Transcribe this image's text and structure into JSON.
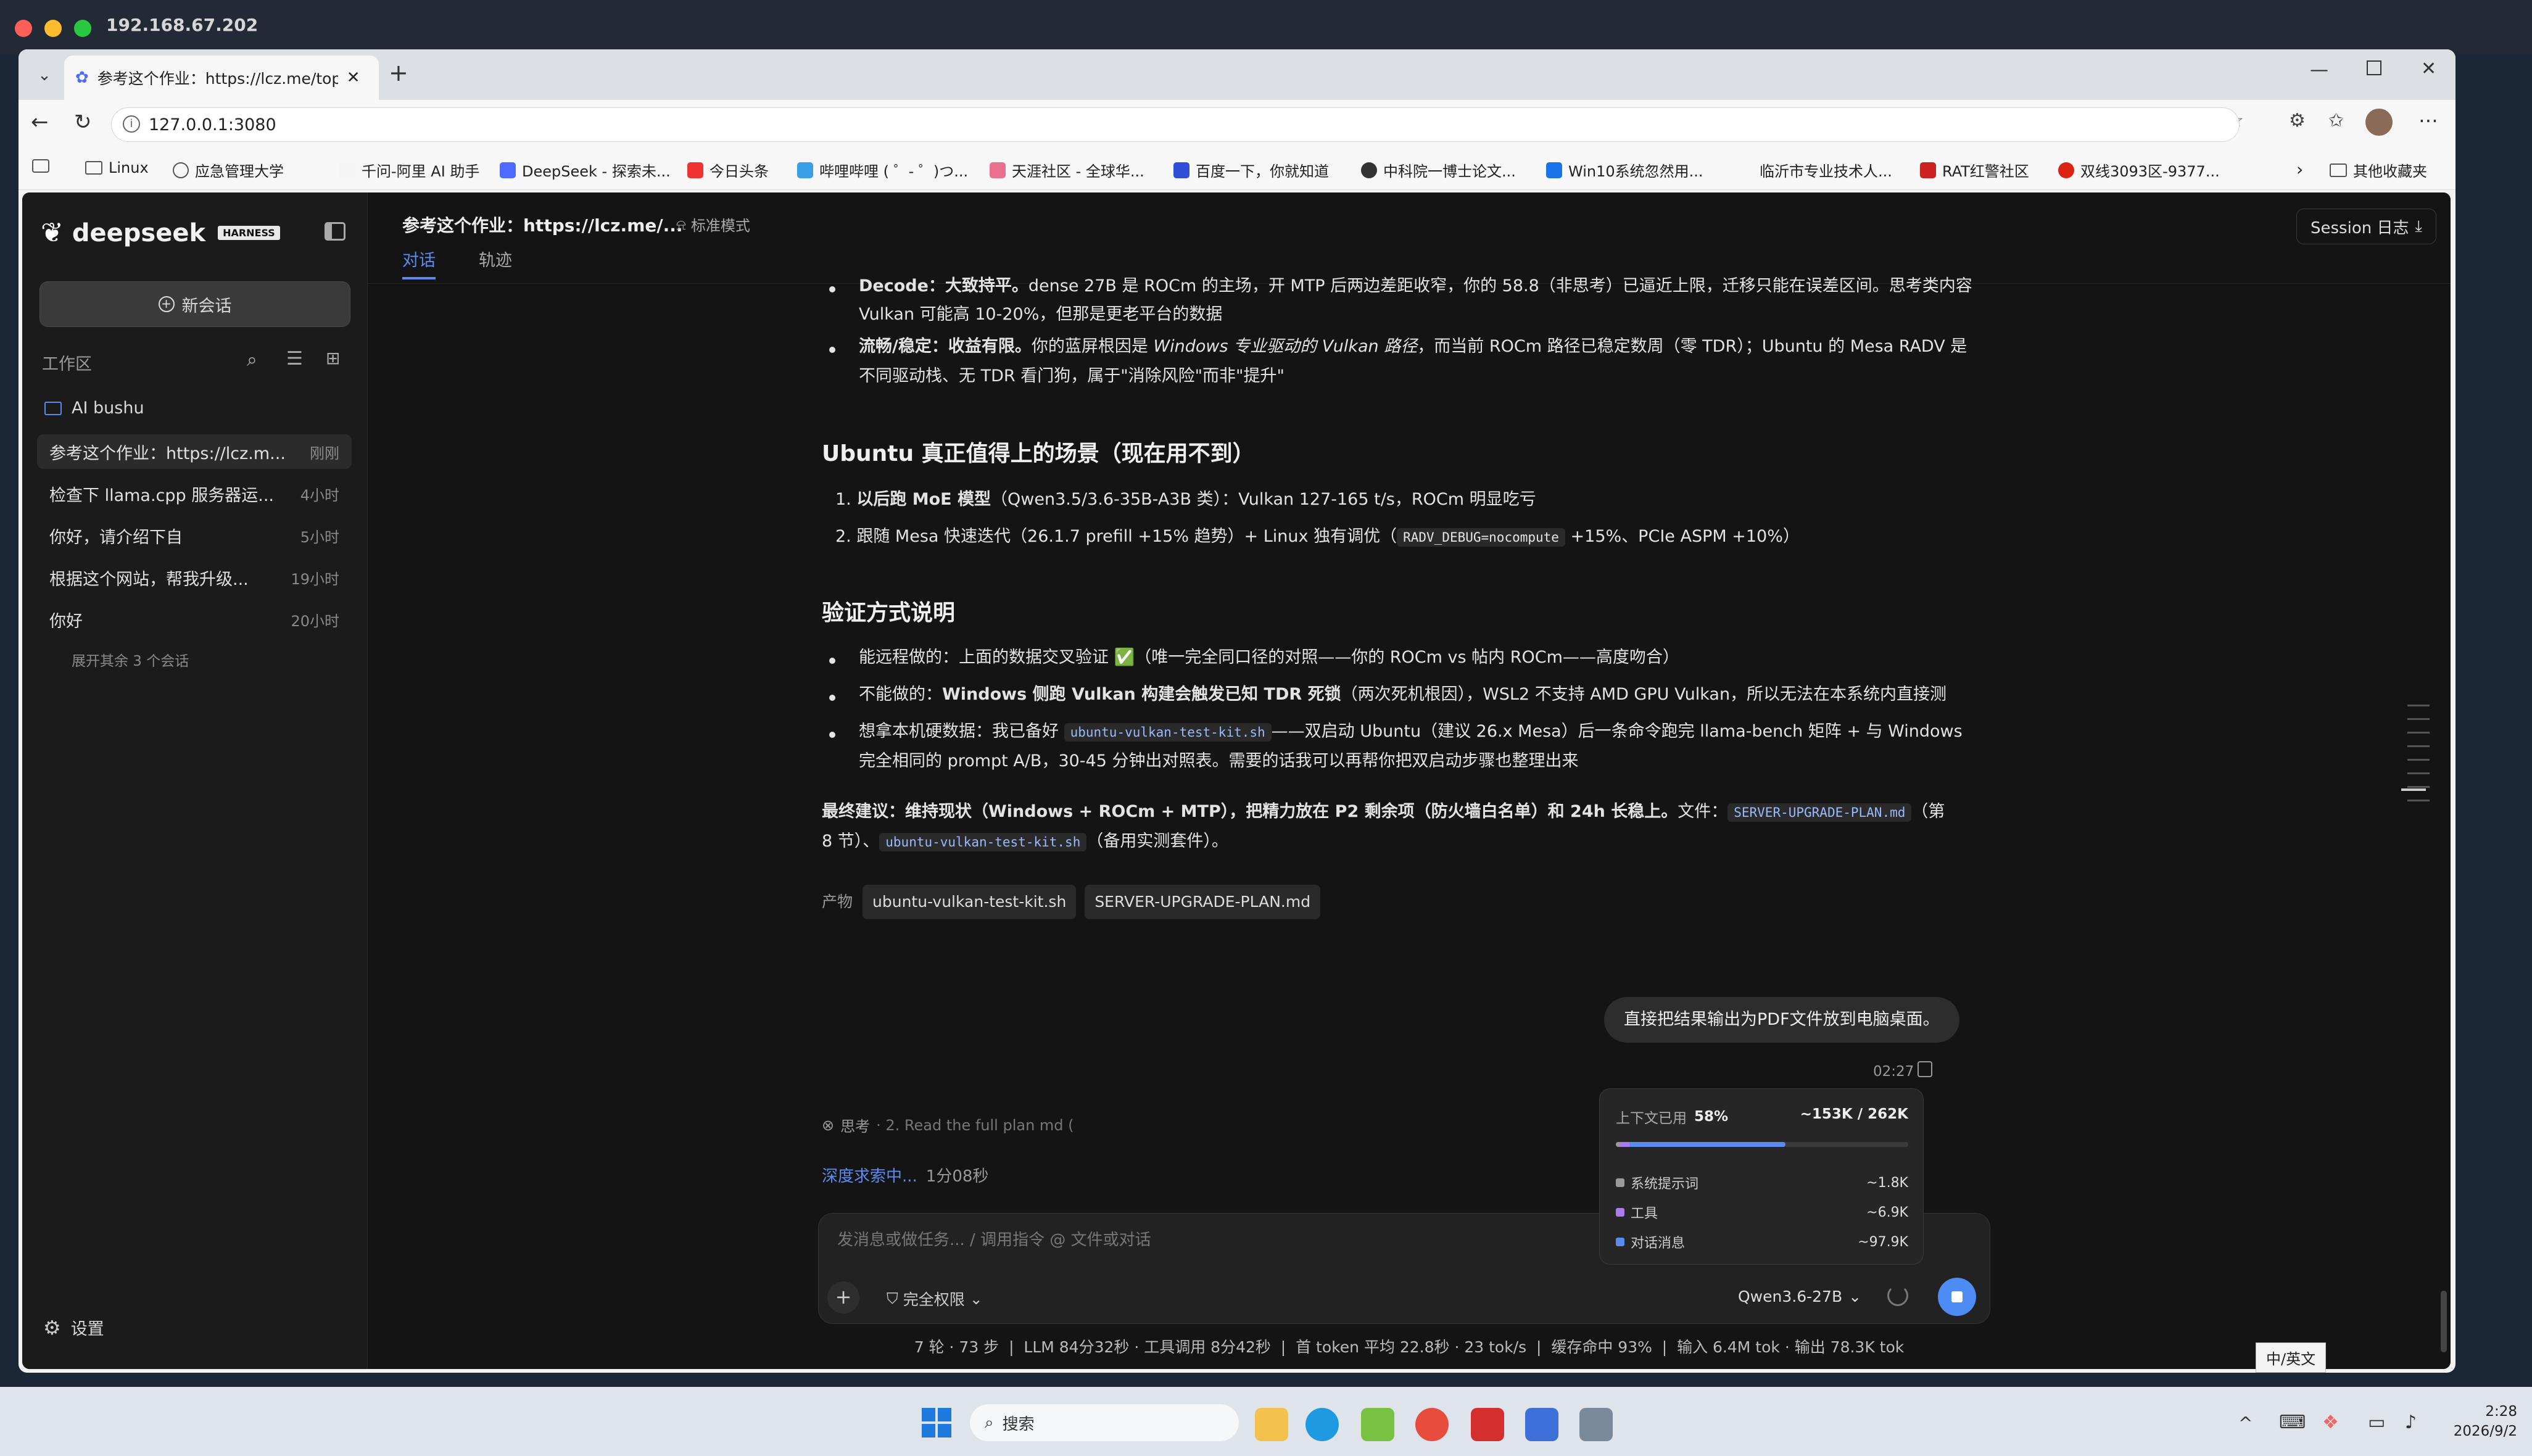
{
  "outer": {
    "host": "192.168.67.202"
  },
  "browser": {
    "tab_title": "参考这个作业：https://lcz.me/top",
    "url": "127.0.0.1:3080",
    "bookmarks": [
      "Linux",
      "应急管理大学",
      "千问-阿里 AI 助手",
      "DeepSeek - 探索未...",
      "今日头条",
      "哔哩哔哩 ( ゜- ゜)つ...",
      "天涯社区 - 全球华...",
      "百度一下，你就知道",
      "中科院一博士论文...",
      "Win10系统忽然用...",
      "临沂市专业技术人...",
      "RAT红警社区",
      "双线3093区-9377..."
    ],
    "bookmarks_other": "其他收藏夹"
  },
  "sidebar": {
    "brand": "deepseek",
    "brand_badge": "HARNESS",
    "new_chat": "新会话",
    "workspace_label": "工作区",
    "folder": "AI bushu",
    "conversations": [
      {
        "title": "参考这个作业：https://lcz.m...",
        "time": "刚刚"
      },
      {
        "title": "检查下 llama.cpp 服务器运...",
        "time": "4小时"
      },
      {
        "title": "你好，请介绍下自",
        "time": "5小时"
      },
      {
        "title": "根据这个网站，帮我升级...",
        "time": "19小时"
      },
      {
        "title": "你好",
        "time": "20小时"
      }
    ],
    "expand_more": "展开其余 3 个会话",
    "settings": "设置"
  },
  "header": {
    "title": "参考这个作业：https://lcz.me/...",
    "mode": "标准模式",
    "tabs": [
      "对话",
      "轨迹"
    ],
    "session_log": "Session 日志"
  },
  "content": {
    "p1a_bold": "Decode：大致持平。",
    "p1a_rest": "dense 27B 是 ROCm 的主场，开 MTP 后两边差距收窄，你的 58.8（非思考）已逼近上限，迁移只能在误差区间。思考类内容",
    "p1b": "Vulkan 可能高 10-20%，但那是更老平台的数据",
    "p2a_bold": "流畅/稳定：收益有限。",
    "p2a_rest1": "你的蓝屏根因是 ",
    "p2a_italic": "Windows 专业驱动的 Vulkan 路径",
    "p2a_rest2": "，而当前 ROCm 路径已稳定数周（零 TDR）；Ubuntu 的 Mesa RADV 是",
    "p2b": "不同驱动栈、无 TDR 看门狗，属于\"消除风险\"而非\"提升\"",
    "h1": "Ubuntu 真正值得上的场景（现在用不到）",
    "ol1_bold": "以后跑 MoE 模型",
    "ol1_rest": "（Qwen3.5/3.6-35B-A3B 类）：Vulkan 127-165 t/s，ROCm 明显吃亏",
    "ol2_a": "跟随 Mesa 快速迭代（26.1.7 prefill +15% 趋势）+ Linux 独有调优（",
    "ol2_code": "RADV_DEBUG=nocompute",
    "ol2_b": " +15%、PCIe ASPM +10%）",
    "h2": "验证方式说明",
    "v1": "能远程做的：上面的数据交叉验证 ✅（唯一完全同口径的对照——你的 ROCm vs 帖内 ROCm——高度吻合）",
    "v2_a": "不能做的：",
    "v2_bold": "Windows 侧跑 Vulkan 构建会触发已知 TDR 死锁",
    "v2_b": "（两次死机根因），WSL2 不支持 AMD GPU Vulkan，所以无法在本系统内直接测",
    "v3_a": "想拿本机硬数据：我已备好 ",
    "v3_code": "ubuntu-vulkan-test-kit.sh",
    "v3_b": "——双启动 Ubuntu（建议 26.x Mesa）后一条命令跑完 llama-bench 矩阵 + 与 Windows",
    "v3_c": "完全相同的 prompt A/B，30-45 分钟出对照表。需要的话我可以再帮你把双启动步骤也整理出来",
    "final_bold": "最终建议：维持现状（Windows + ROCm + MTP），把精力放在 P2 剩余项（防火墙白名单）和 24h 长稳上。",
    "final_a": "文件：",
    "final_code1": "SERVER-UPGRADE-PLAN.md",
    "final_b": "（第",
    "final_c": "8 节）、",
    "final_code2": "ubuntu-vulkan-test-kit.sh",
    "final_d": "（备用实测套件）。",
    "artifacts_label": "产物",
    "artifacts": [
      "ubuntu-vulkan-test-kit.sh",
      "SERVER-UPGRADE-PLAN.md"
    ],
    "user_msg": "直接把结果输出为PDF文件放到电脑桌面。",
    "user_time": "02:27",
    "thinking_label": "思考",
    "thinking_text": "· 2. Read the full plan md (",
    "deep_search": "深度求索中...",
    "elapsed": "1分08秒"
  },
  "context_popup": {
    "label": "上下文已用",
    "percent": "58%",
    "usage": "~153K / 262K",
    "fill_fraction": 0.58,
    "items": [
      {
        "name": "系统提示词",
        "value": "~1.8K",
        "color": "#9a9a9a"
      },
      {
        "name": "工具",
        "value": "~6.9K",
        "color": "#a77ee8"
      },
      {
        "name": "对话消息",
        "value": "~97.9K",
        "color": "#5a8cf0"
      }
    ]
  },
  "composer": {
    "placeholder": "发消息或做任务... / 调用指令 @ 文件或对话",
    "permission": "完全权限",
    "model": "Qwen3.6-27B"
  },
  "stats": "7 轮 · 73 步  |  LLM 84分32秒 · 工具调用 8分42秒  |  首 token 平均 22.8秒 · 23 tok/s  |  缓存命中 93%  |  输入 6.4M tok · 输出 78.3K tok",
  "taskbar": {
    "search": "搜索",
    "ime": "中/英文",
    "time": "2:28",
    "date": "2026/9/2"
  }
}
